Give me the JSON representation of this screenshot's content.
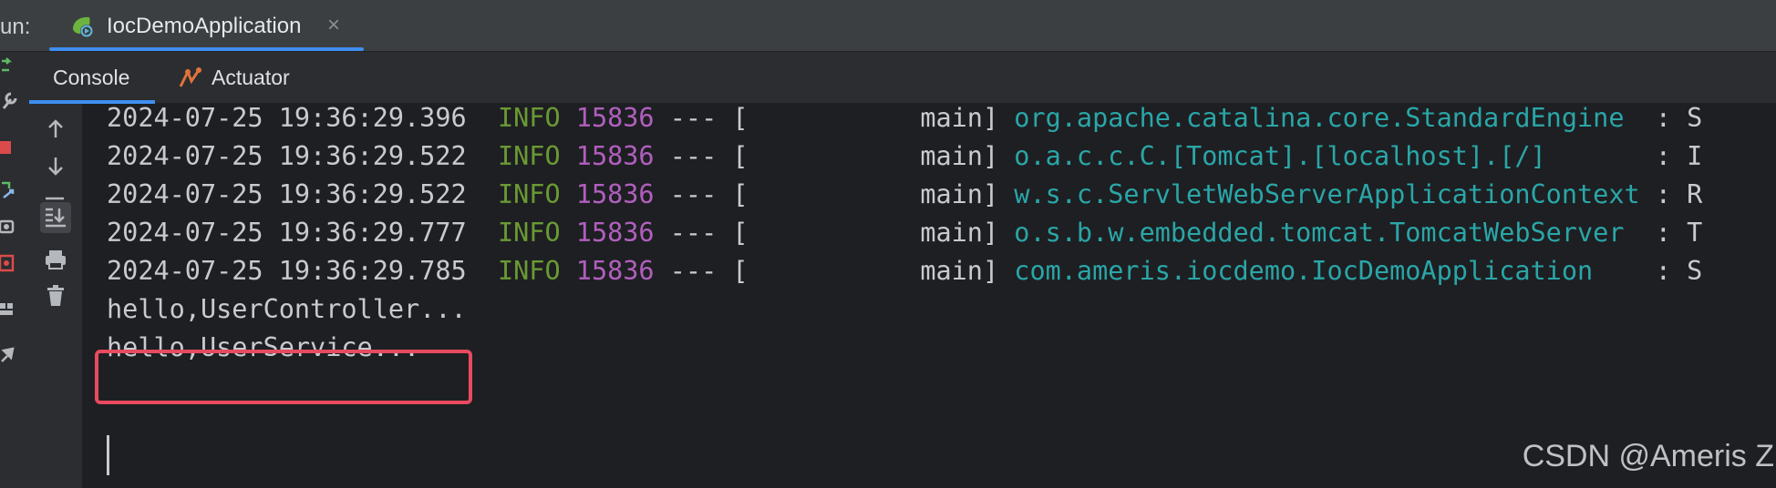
{
  "run_panel": {
    "label": "un:",
    "tab": {
      "title": "IocDemoApplication",
      "icon": "spring-boot-run-icon",
      "close": "×"
    }
  },
  "console_tabs": [
    {
      "label": "Console",
      "active": true
    },
    {
      "label": "Actuator",
      "icon": "actuator-icon",
      "active": false
    }
  ],
  "toolbar": {
    "buttons": [
      {
        "name": "scroll-up-icon"
      },
      {
        "name": "scroll-down-icon"
      },
      {
        "name": "soft-wrap-icon"
      },
      {
        "name": "scroll-to-end-icon",
        "active": true
      },
      {
        "name": "print-icon"
      },
      {
        "name": "clear-icon"
      }
    ]
  },
  "log": {
    "entries": [
      {
        "timestamp": "2024-07-25 19:36:29.396",
        "level": "INFO",
        "pid": "15836",
        "sep": "---",
        "thread": "[           main]",
        "logger": "org.apache.catalina.core.StandardEngine",
        "tail": "  : S"
      },
      {
        "timestamp": "2024-07-25 19:36:29.522",
        "level": "INFO",
        "pid": "15836",
        "sep": "---",
        "thread": "[           main]",
        "logger": "o.a.c.c.C.[Tomcat].[localhost].[/]",
        "tail": "       : I"
      },
      {
        "timestamp": "2024-07-25 19:36:29.522",
        "level": "INFO",
        "pid": "15836",
        "sep": "---",
        "thread": "[           main]",
        "logger": "w.s.c.ServletWebServerApplicationContext",
        "tail": " : R"
      },
      {
        "timestamp": "2024-07-25 19:36:29.777",
        "level": "INFO",
        "pid": "15836",
        "sep": "---",
        "thread": "[           main]",
        "logger": "o.s.b.w.embedded.tomcat.TomcatWebServer",
        "tail": "  : T"
      },
      {
        "timestamp": "2024-07-25 19:36:29.785",
        "level": "INFO",
        "pid": "15836",
        "sep": "---",
        "thread": "[           main]",
        "logger": "com.ameris.iocdemo.IocDemoApplication",
        "tail": "    : S"
      }
    ],
    "plain_lines": [
      "hello,UserController...",
      "hello,UserService..."
    ]
  },
  "colors": {
    "info": "#6a9a34",
    "pid": "#b05fbe",
    "logger": "#2aa6a8",
    "highlight": "#e84a5f",
    "accent": "#3f8ef0"
  },
  "watermark": "CSDN @Ameris Z"
}
